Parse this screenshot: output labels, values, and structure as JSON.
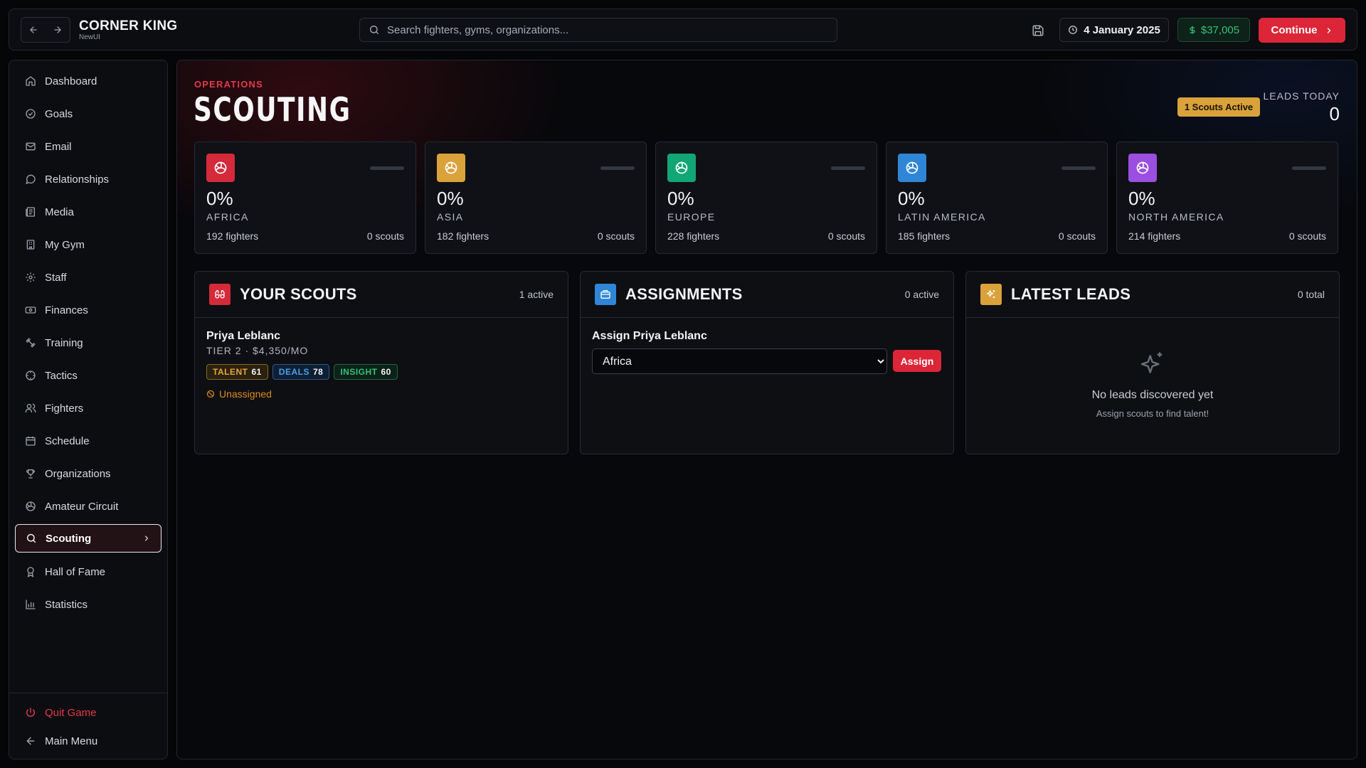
{
  "app": {
    "title": "CORNER KING",
    "subtitle": "NewUI"
  },
  "search": {
    "placeholder": "Search fighters, gyms, organizations..."
  },
  "header": {
    "date": "4 January 2025",
    "money": "$37,005",
    "continue_label": "Continue"
  },
  "sidebar": {
    "items": [
      {
        "label": "Dashboard",
        "icon": "home-icon"
      },
      {
        "label": "Goals",
        "icon": "target-icon"
      },
      {
        "label": "Email",
        "icon": "mail-icon"
      },
      {
        "label": "Relationships",
        "icon": "chat-bubble-icon"
      },
      {
        "label": "Media",
        "icon": "newspaper-icon"
      },
      {
        "label": "My Gym",
        "icon": "building-icon"
      },
      {
        "label": "Staff",
        "icon": "gear-icon"
      },
      {
        "label": "Finances",
        "icon": "banknote-icon"
      },
      {
        "label": "Training",
        "icon": "dumbbell-icon"
      },
      {
        "label": "Tactics",
        "icon": "crosshair-icon"
      },
      {
        "label": "Fighters",
        "icon": "users-icon"
      },
      {
        "label": "Schedule",
        "icon": "calendar-icon"
      },
      {
        "label": "Organizations",
        "icon": "trophy-icon"
      },
      {
        "label": "Amateur Circuit",
        "icon": "volleyball-icon"
      },
      {
        "label": "Scouting",
        "icon": "search-icon",
        "active": true
      },
      {
        "label": "Hall of Fame",
        "icon": "award-icon"
      },
      {
        "label": "Statistics",
        "icon": "bar-chart-icon"
      }
    ],
    "quit_label": "Quit Game",
    "main_menu_label": "Main Menu"
  },
  "page": {
    "kicker": "OPERATIONS",
    "title": "SCOUTING",
    "scouts_active_badge": "1 Scouts Active",
    "leads_today_label": "LEADS TODAY",
    "leads_today_value": "0"
  },
  "regions": [
    {
      "percent": "0%",
      "name": "AFRICA",
      "fighters": "192 fighters",
      "scouts": "0 scouts",
      "color": "#d42a3a",
      "progress": 0
    },
    {
      "percent": "0%",
      "name": "ASIA",
      "fighters": "182 fighters",
      "scouts": "0 scouts",
      "color": "#d9a23a",
      "progress": 0
    },
    {
      "percent": "0%",
      "name": "EUROPE",
      "fighters": "228 fighters",
      "scouts": "0 scouts",
      "color": "#12a674",
      "progress": 0
    },
    {
      "percent": "0%",
      "name": "LATIN AMERICA",
      "fighters": "185 fighters",
      "scouts": "0 scouts",
      "color": "#2f86d6",
      "progress": 0
    },
    {
      "percent": "0%",
      "name": "NORTH AMERICA",
      "fighters": "214 fighters",
      "scouts": "0 scouts",
      "color": "#9b4fe0",
      "progress": 0
    }
  ],
  "scouts_panel": {
    "title": "YOUR SCOUTS",
    "count": "1 active",
    "icon_color": "#d42a3a",
    "scout": {
      "name": "Priya Leblanc",
      "tier": "TIER 2 · $4,350/MO",
      "talent_label": "TALENT",
      "talent_value": "61",
      "deals_label": "DEALS",
      "deals_value": "78",
      "insight_label": "INSIGHT",
      "insight_value": "60",
      "status": "Unassigned"
    }
  },
  "assignments_panel": {
    "title": "ASSIGNMENTS",
    "count": "0 active",
    "icon_color": "#2f86d6",
    "assign_label": "Assign Priya Leblanc",
    "selected_region": "Africa",
    "assign_button": "Assign"
  },
  "leads_panel": {
    "title": "LATEST LEADS",
    "count": "0 total",
    "icon_color": "#d9a23a",
    "empty_title": "No leads discovered yet",
    "empty_subtitle": "Assign scouts to find talent!"
  }
}
